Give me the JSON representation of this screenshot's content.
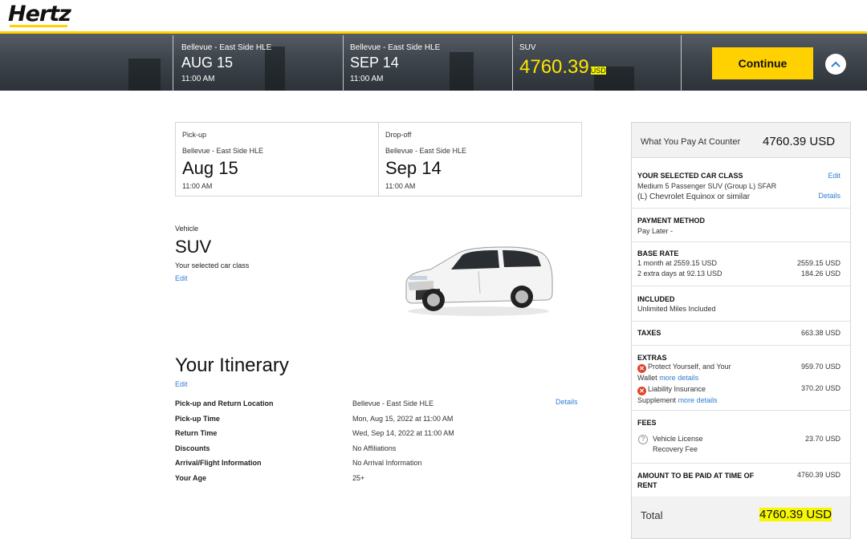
{
  "brand": {
    "logo_text": "Hertz",
    "accent": "#ffd100",
    "highlight": "#f7f700",
    "link_color": "#2f7fd3"
  },
  "topbar": {
    "pickup": {
      "location": "Bellevue - East Side HLE",
      "date": "AUG 15",
      "time": "11:00 AM"
    },
    "dropoff": {
      "location": "Bellevue - East Side HLE",
      "date": "SEP 14",
      "time": "11:00 AM"
    },
    "vehicle": {
      "class": "SUV",
      "price": "4760.39",
      "currency": "USD"
    },
    "continue_label": "Continue",
    "collapse_icon": "chevron-up-icon"
  },
  "pickup_dropoff": {
    "pickup": {
      "label": "Pick-up",
      "location": "Bellevue - East Side HLE",
      "date": "Aug 15",
      "time": "11:00 AM"
    },
    "dropoff": {
      "label": "Drop-off",
      "location": "Bellevue - East Side HLE",
      "date": "Sep 14",
      "time": "11:00 AM"
    }
  },
  "vehicle": {
    "label": "Vehicle",
    "name": "SUV",
    "subtitle": "Your selected car class",
    "edit_label": "Edit",
    "image": "white-suv-image"
  },
  "itinerary": {
    "title": "Your Itinerary",
    "edit_label": "Edit",
    "details_label": "Details",
    "rows": [
      {
        "key": "Pick-up and Return Location",
        "value": "Bellevue - East Side HLE"
      },
      {
        "key": "Pick-up Time",
        "value": "Mon, Aug 15, 2022 at 11:00 AM"
      },
      {
        "key": "Return Time",
        "value": "Wed, Sep 14, 2022 at 11:00 AM"
      },
      {
        "key": "Discounts",
        "value": "No Affiliations"
      },
      {
        "key": "Arrival/Flight Information",
        "value": "No Arrival Information"
      },
      {
        "key": "Your Age",
        "value": "25+"
      }
    ]
  },
  "summary": {
    "header_label": "What You Pay At Counter",
    "header_value": "4760.39 USD",
    "car_class": {
      "heading": "YOUR SELECTED CAR CLASS",
      "line1": "Medium 5 Passenger SUV (Group L) SFAR",
      "line2": "(L) Chevrolet Equinox or similar",
      "edit_label": "Edit",
      "details_label": "Details"
    },
    "payment": {
      "heading": "PAYMENT METHOD",
      "value": "Pay Later -"
    },
    "base_rate": {
      "heading": "BASE RATE",
      "lines": [
        {
          "label": "1 month at 2559.15 USD",
          "amount": "2559.15 USD"
        },
        {
          "label": "2 extra days at 92.13 USD",
          "amount": "184.26 USD"
        }
      ]
    },
    "included": {
      "heading": "INCLUDED",
      "value": "Unlimited Miles Included"
    },
    "taxes": {
      "heading": "TAXES",
      "amount": "663.38 USD"
    },
    "extras": {
      "heading": "EXTRAS",
      "items": [
        {
          "line1": "Protect Yourself, and Your",
          "line2": "Wallet",
          "link": "more details",
          "amount": "959.70 USD"
        },
        {
          "line1": "Liability Insurance",
          "line2": "Supplement",
          "link": "more details",
          "amount": "370.20 USD"
        }
      ]
    },
    "fees": {
      "heading": "FEES",
      "line1": "Vehicle License",
      "line2": "Recovery Fee",
      "amount": "23.70 USD"
    },
    "amount_due": {
      "line1": "AMOUNT TO BE PAID AT TIME OF",
      "line2": "RENT",
      "amount": "4760.39 USD"
    },
    "total": {
      "label": "Total",
      "value": "4760.39 USD"
    }
  }
}
